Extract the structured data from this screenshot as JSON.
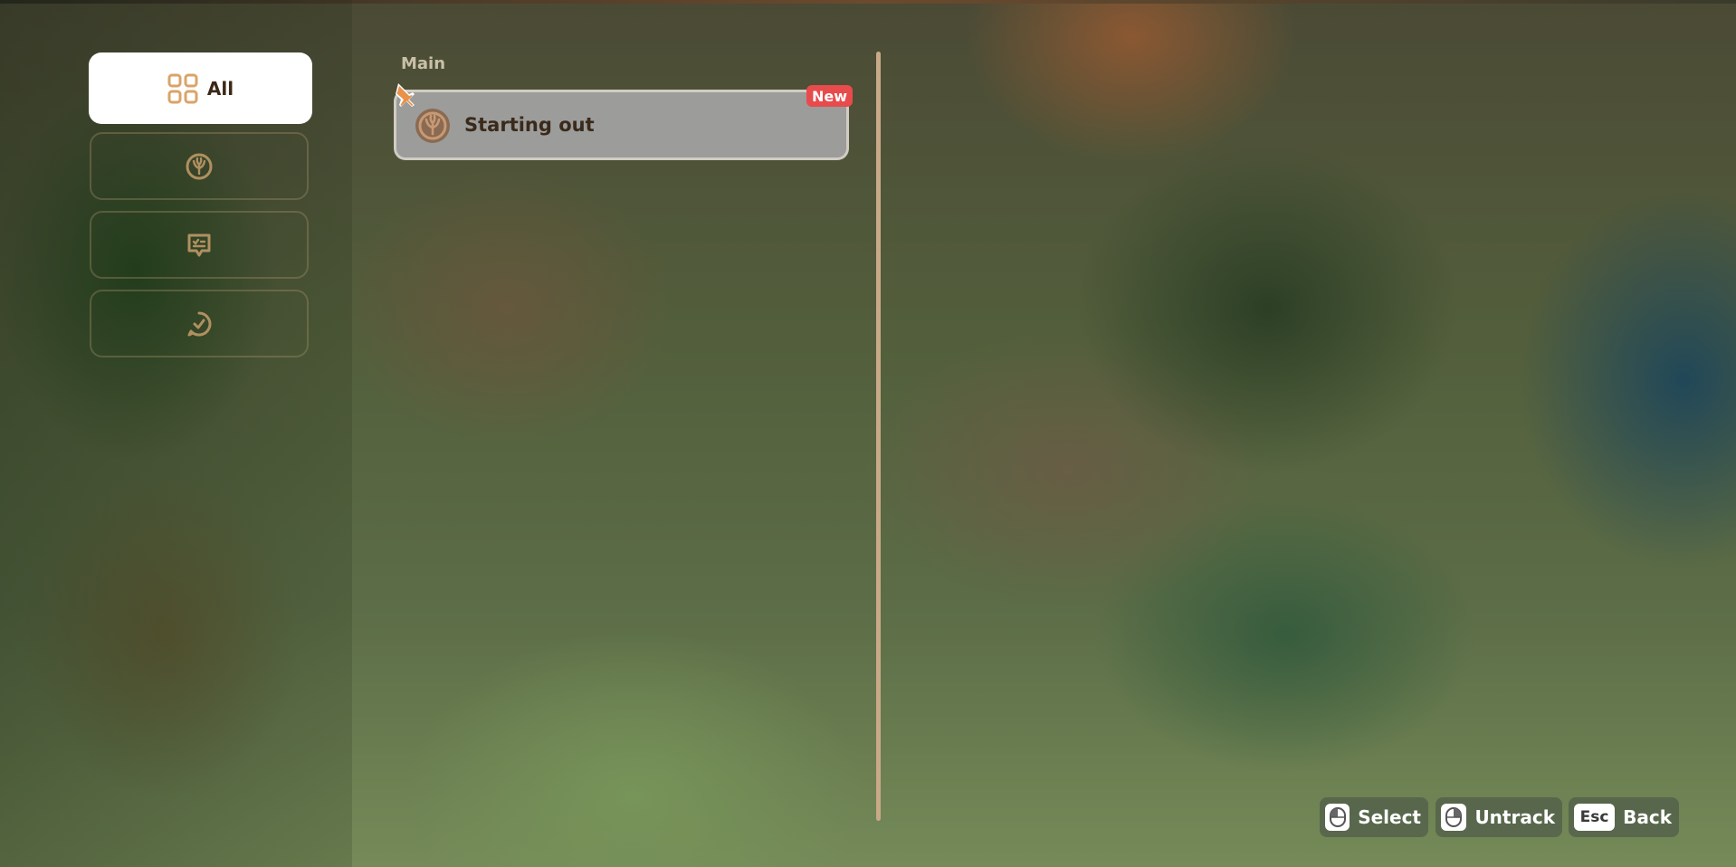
{
  "sidebar": {
    "categories": [
      {
        "label": "All",
        "icon": "grid-icon",
        "active": true
      },
      {
        "label": "",
        "icon": "sprout-icon",
        "active": false
      },
      {
        "label": "",
        "icon": "task-chat-icon",
        "active": false
      },
      {
        "label": "",
        "icon": "check-chat-icon",
        "active": false
      }
    ]
  },
  "quest_list": {
    "section_label": "Main",
    "quests": [
      {
        "title": "Starting out",
        "badge": "New",
        "icon": "sprout-icon",
        "pinned": true
      }
    ]
  },
  "controls": {
    "select": {
      "key_icon": "mouse-left-icon",
      "label": "Select"
    },
    "untrack": {
      "key_icon": "mouse-right-icon",
      "label": "Untrack"
    },
    "back": {
      "key": "Esc",
      "label": "Back"
    }
  },
  "colors": {
    "accent": "#d9a46a",
    "badge": "#e84b4b",
    "text_dark": "#3a2a1a"
  }
}
